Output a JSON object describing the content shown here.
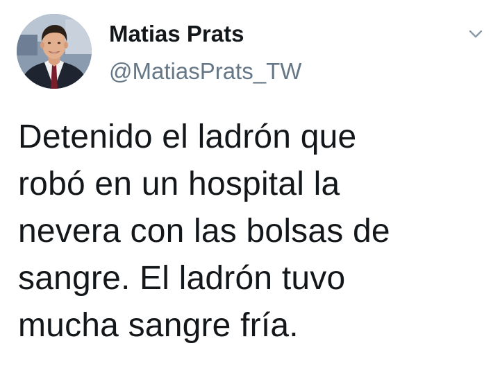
{
  "author": {
    "display_name": "Matias Prats",
    "handle": "@MatiasPrats_TW",
    "avatar_icon": "person-portrait-avatar"
  },
  "menu": {
    "icon": "chevron-down-icon"
  },
  "tweet": {
    "lines": [
      "Detenido el ladrón que",
      "robó en un hospital la",
      "nevera con las bolsas de",
      "sangre. El ladrón tuvo",
      "mucha sangre fría."
    ]
  },
  "colors": {
    "text_primary": "#14171a",
    "text_secondary": "#657786",
    "chevron": "#8899a6",
    "background": "#ffffff"
  }
}
